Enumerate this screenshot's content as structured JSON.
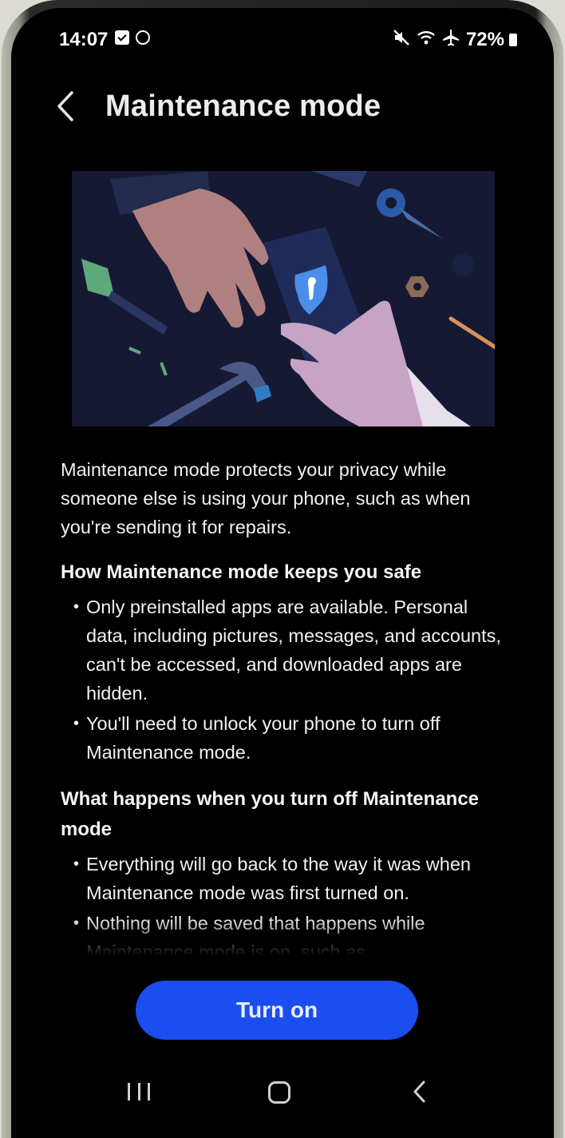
{
  "status_bar": {
    "time": "14:07",
    "battery": "72%",
    "icons": [
      "screenshot-icon",
      "sync-icon",
      "mute-icon",
      "wifi-icon",
      "airplane-icon",
      "battery-icon"
    ]
  },
  "header": {
    "title": "Maintenance mode",
    "back_icon": "chevron-left-icon"
  },
  "content": {
    "intro": "Maintenance mode protects your privacy while someone else is using your phone, such as when you're sending it for repairs.",
    "sections": [
      {
        "heading": "How Maintenance mode keeps you safe",
        "bullets": [
          "Only preinstalled apps are available. Personal data, including pictures, messages, and accounts, can't be accessed, and downloaded apps are hidden.",
          "You'll need to unlock your phone to turn off Maintenance mode."
        ]
      },
      {
        "heading": "What happens when you turn off Maintenance mode",
        "bullets": [
          "Everything will go back to the way it was when Maintenance mode was first turned on.",
          "Nothing will be saved that happens while Maintenance mode is on, such as"
        ]
      }
    ]
  },
  "actions": {
    "turn_on_label": "Turn on"
  },
  "colors": {
    "primary_button": "#1a4ef0",
    "background": "#000000",
    "text": "#f1f1f1"
  },
  "nav_bar": {
    "icons": [
      "recent-apps-icon",
      "home-icon",
      "back-icon"
    ]
  }
}
